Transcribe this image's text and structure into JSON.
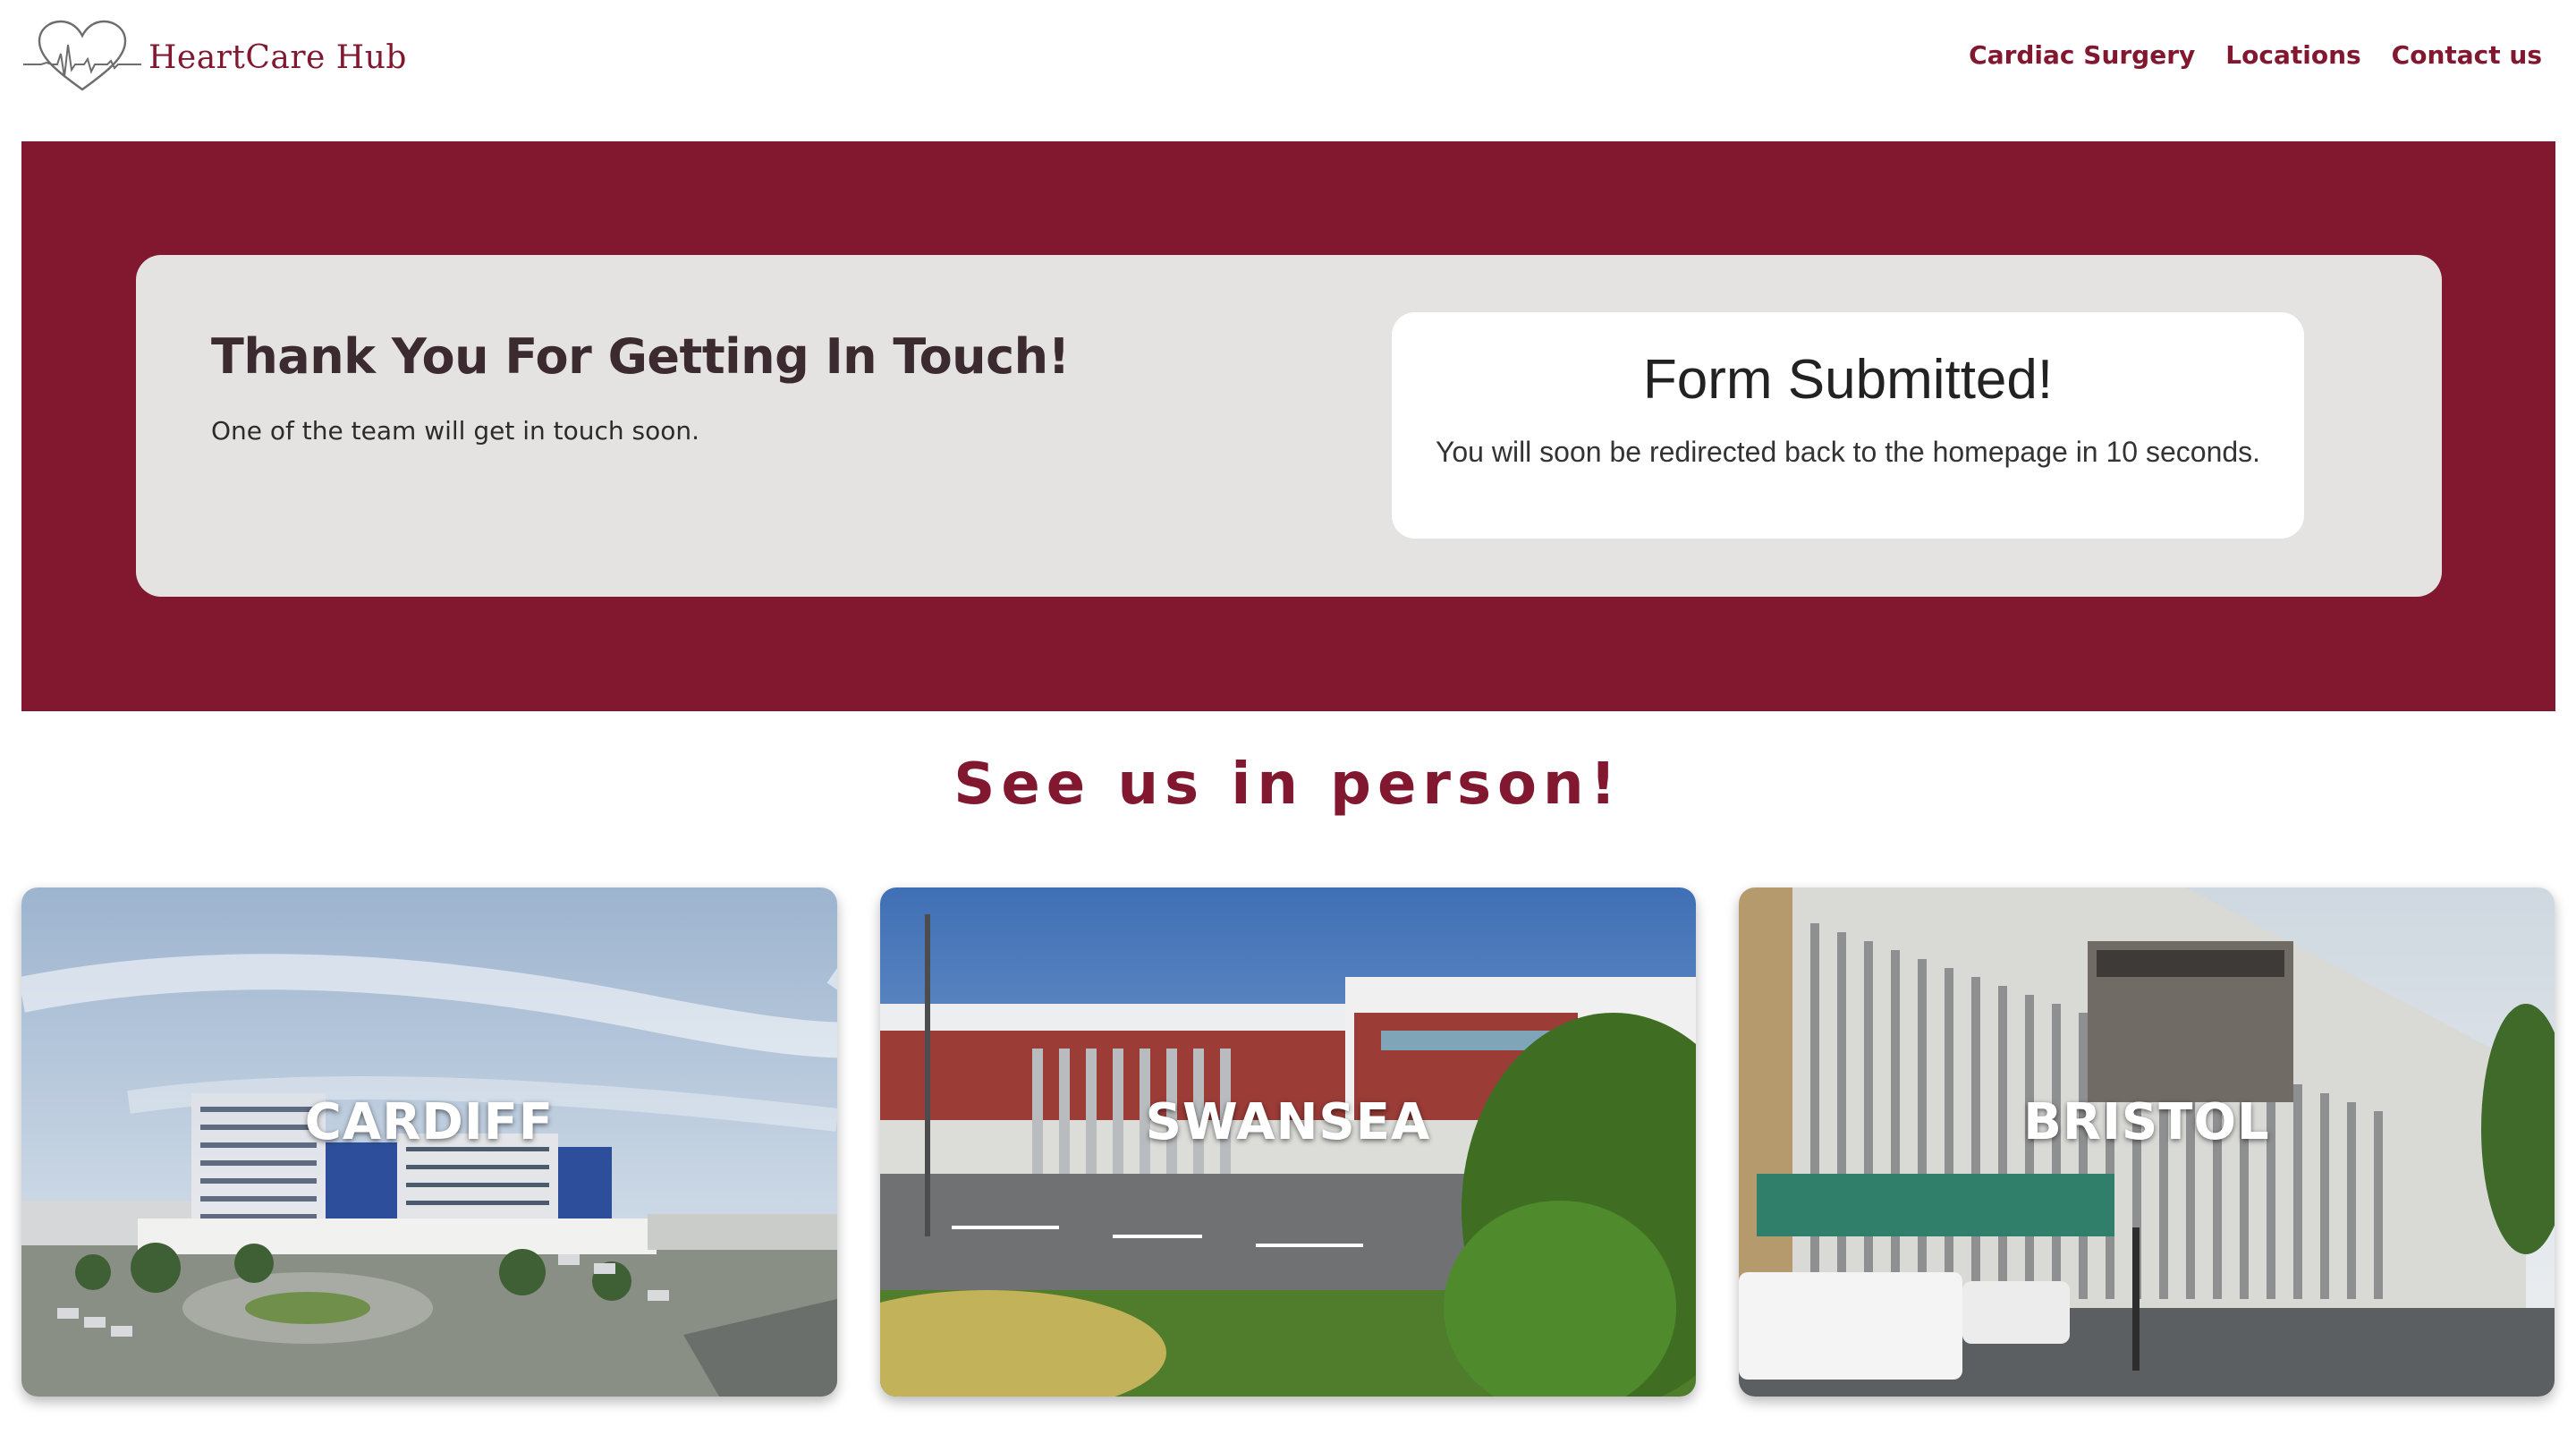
{
  "brand": {
    "name": "HeartCare Hub",
    "color": "#82182f",
    "logo_icon": "heart-ecg-icon"
  },
  "nav": {
    "items": [
      {
        "label": "Cardiac Surgery"
      },
      {
        "label": "Locations"
      },
      {
        "label": "Contact us"
      }
    ]
  },
  "hero": {
    "background": "#82182f",
    "title": "Thank You For Getting In Touch!",
    "subtitle": "One of the team will get in touch soon.",
    "notice": {
      "title": "Form Submitted!",
      "message": "You will soon be redirected back to the homepage in 10 seconds."
    }
  },
  "locations": {
    "title": "See us in person!",
    "items": [
      {
        "name": "CARDIFF"
      },
      {
        "name": "SWANSEA"
      },
      {
        "name": "BRISTOL"
      }
    ]
  }
}
